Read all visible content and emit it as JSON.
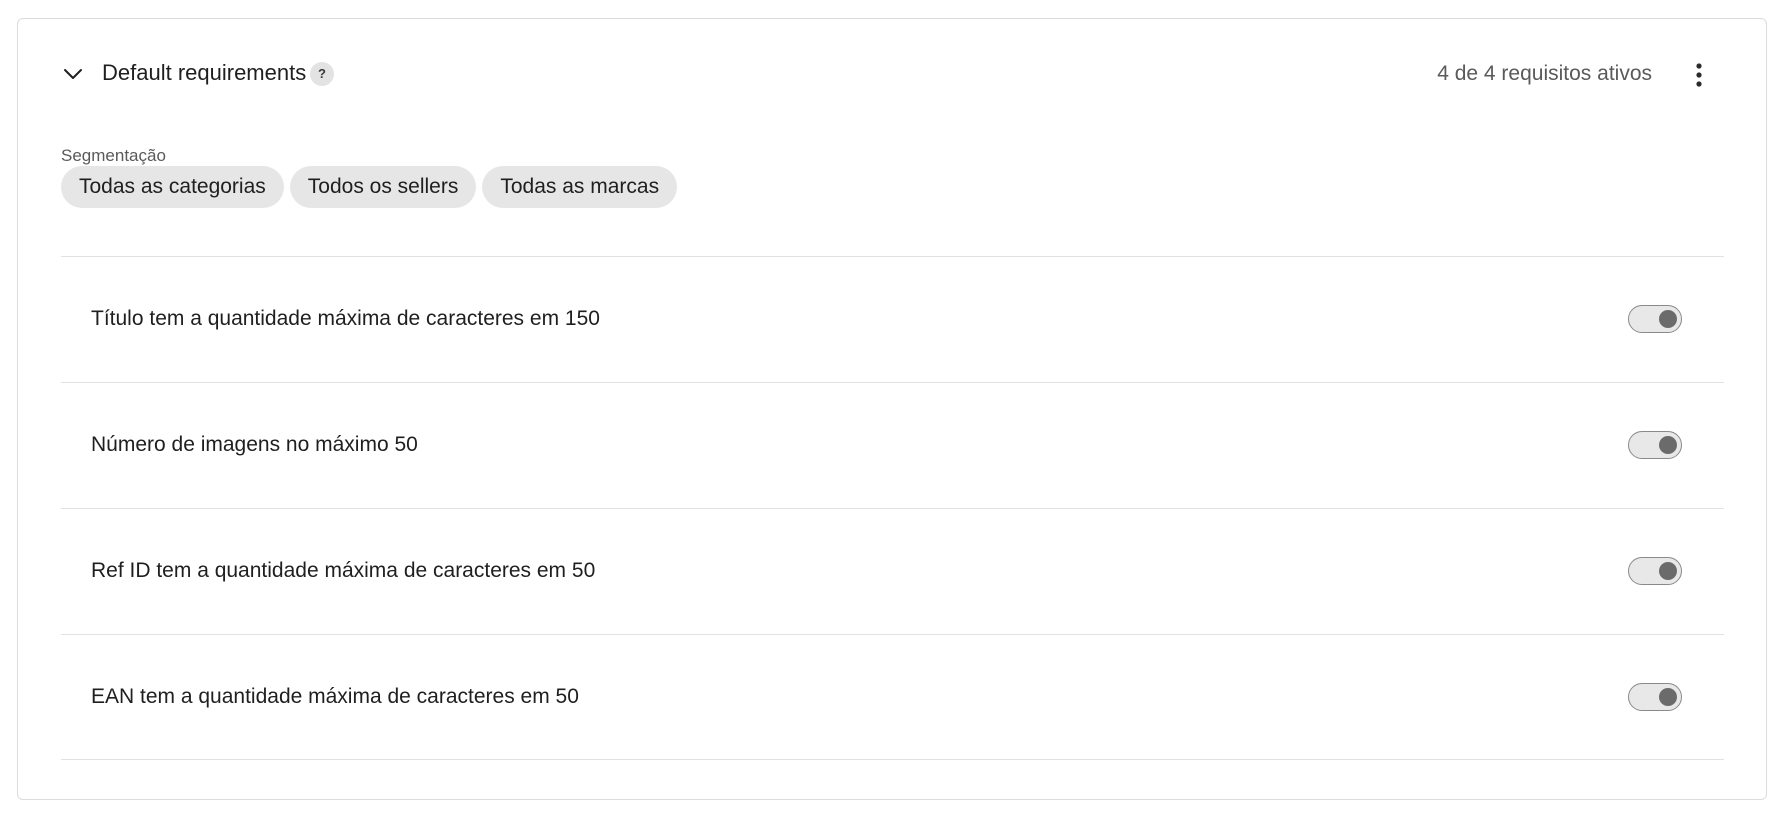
{
  "section": {
    "title": "Default requirements",
    "help_label": "?",
    "active_count": "4 de 4 requisitos ativos",
    "icons": {
      "collapse": "chevron-down-icon",
      "help": "question-icon",
      "menu": "more-vertical-icon"
    }
  },
  "segmentation": {
    "label": "Segmentação",
    "chips": [
      "Todas as categorias",
      "Todos os sellers",
      "Todas as marcas"
    ]
  },
  "requirements": [
    {
      "label": "Título tem a quantidade máxima de caracteres em 150",
      "enabled": true
    },
    {
      "label": "Número de imagens no máximo 50",
      "enabled": true
    },
    {
      "label": "Ref ID tem a quantidade máxima de caracteres em 50",
      "enabled": true
    },
    {
      "label": "EAN tem a quantidade máxima de caracteres em 50",
      "enabled": true
    }
  ],
  "colors": {
    "chip_background": "#e6e6e6",
    "toggle_track": "#e8e8e8",
    "toggle_knob": "#6b6b6b",
    "divider": "#e2e2e2"
  }
}
